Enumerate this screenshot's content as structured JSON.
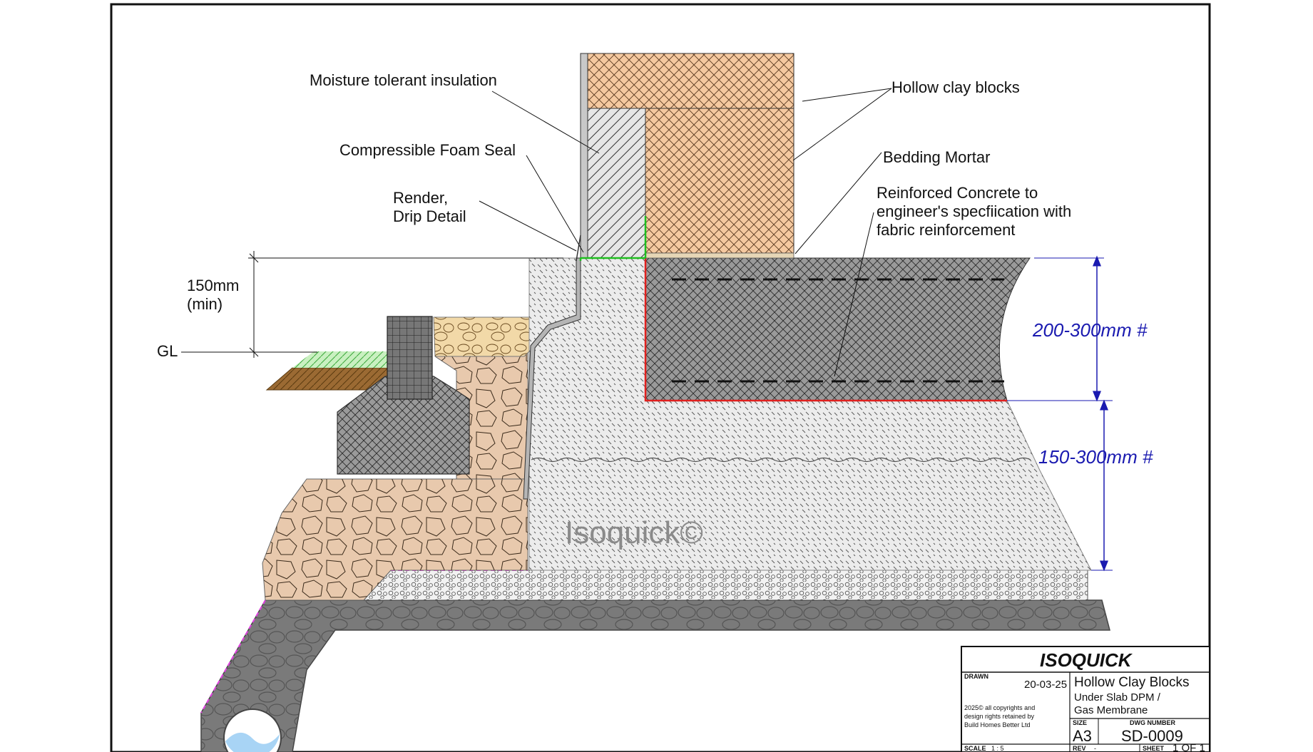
{
  "labels": {
    "moisture_insulation": "Moisture tolerant insulation",
    "foam_seal": "Compressible Foam Seal",
    "render_line1": "Render,",
    "render_line2": "Drip Detail",
    "hollow_clay_blocks": "Hollow clay blocks",
    "bedding_mortar": "Bedding Mortar",
    "concrete_line1": "Reinforced Concrete to",
    "concrete_line2": "engineer's specfiication with",
    "concrete_line3": "fabric reinforcement",
    "dim_150_line1": "150mm",
    "dim_150_line2": "(min)",
    "ground_level": "GL",
    "dim_slab": "200-300mm #",
    "dim_insulation": "150-300mm #",
    "watermark": "Isoquick©"
  },
  "title_block": {
    "brand": "ISOQUICK",
    "drawn_label": "DRAWN",
    "drawn_date": "20-03-25",
    "copyright_line1": "2025© all copyrights and",
    "copyright_line2": "design rights retained by",
    "copyright_line3": "Build Homes Better Ltd",
    "title": "Hollow Clay Blocks",
    "subtitle_line1": "Under Slab DPM /",
    "subtitle_line2": "Gas Membrane",
    "size_label": "SIZE",
    "size_value": "A3",
    "dwg_label": "DWG NUMBER",
    "dwg_value": "SD-0009",
    "scale_label": "SCALE",
    "scale_value": "1 : 5",
    "rev_label": "REV",
    "rev_value": "-",
    "sheet_label": "SHEET",
    "sheet_value": "1 OF 1"
  },
  "colors": {
    "clay_block": "#f5c9a0",
    "concrete_slab": "#9a9a9a",
    "insulation": "#ececec",
    "hardcore": "#7a7a7a",
    "stone_fill": "#e8c9ad",
    "sand": "#f2d9a8",
    "soil": "#9b6a33",
    "grass": "#c9f0c0",
    "dpm_red": "#e0201e",
    "membrane_green": "#1fbf1f",
    "pipe_water": "#a8d4f5",
    "dimension_blue": "#1a1ab0"
  },
  "icons": {
    "drainage_pipe": "drain-pipe-icon"
  }
}
